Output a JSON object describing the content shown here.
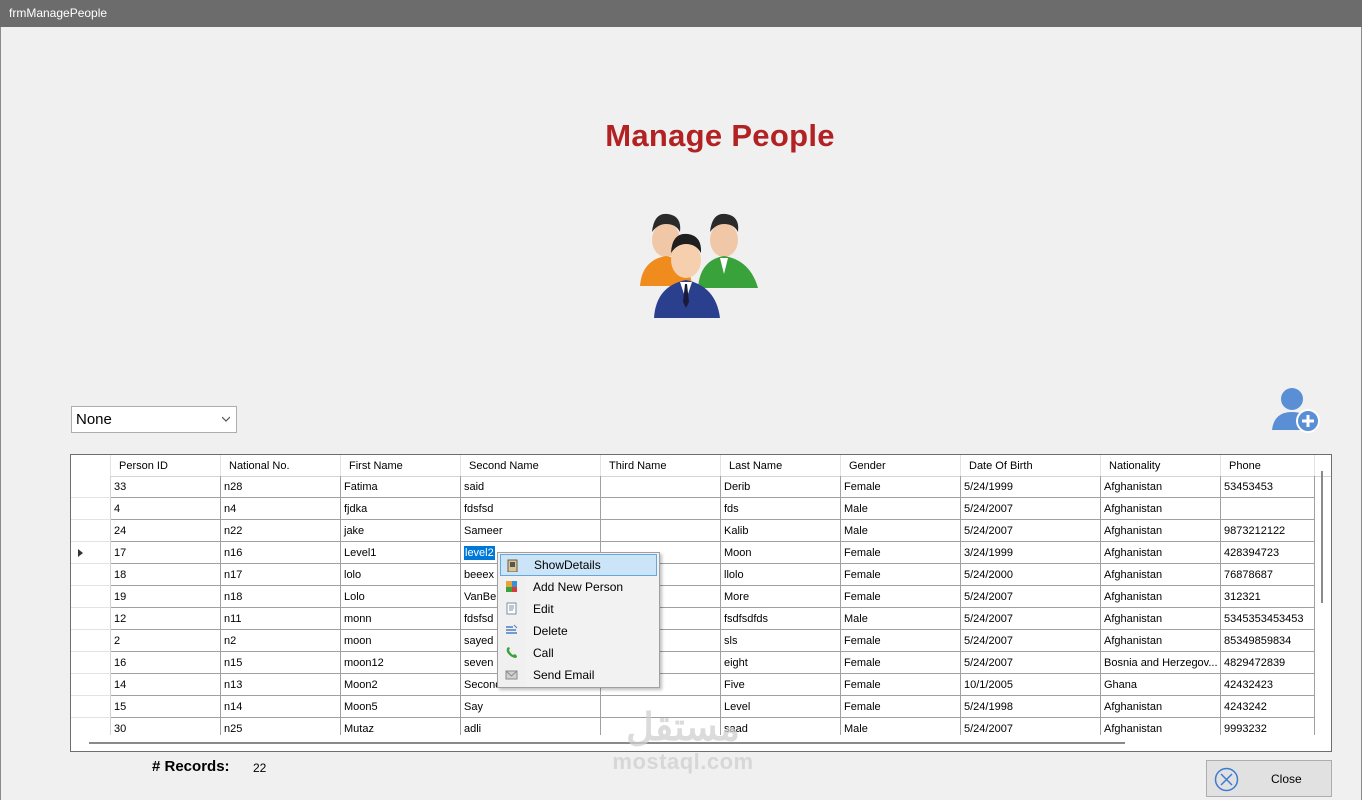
{
  "window": {
    "title": "frmManagePeople"
  },
  "header": {
    "title": "Manage People"
  },
  "filter": {
    "selected": "None"
  },
  "grid": {
    "columns": [
      "Person ID",
      "National No.",
      "First Name",
      "Second Name",
      "Third Name",
      "Last Name",
      "Gender",
      "Date Of Birth",
      "Nationality",
      "Phone"
    ],
    "rows": [
      [
        "33",
        "n28",
        "Fatima",
        "said",
        "",
        "Derib",
        "Female",
        "5/24/1999",
        "Afghanistan",
        "53453453"
      ],
      [
        "4",
        "n4",
        "fjdka",
        "fdsfsd",
        "",
        "fds",
        "Male",
        "5/24/2007",
        "Afghanistan",
        ""
      ],
      [
        "24",
        "n22",
        "jake",
        "Sameer",
        "",
        "Kalib",
        "Male",
        "5/24/2007",
        "Afghanistan",
        "9873212122"
      ],
      [
        "17",
        "n16",
        "Level1",
        "level2",
        "",
        "Moon",
        "Female",
        "3/24/1999",
        "Afghanistan",
        "428394723"
      ],
      [
        "18",
        "n17",
        "lolo",
        "beeex",
        "",
        "llolo",
        "Female",
        "5/24/2000",
        "Afghanistan",
        "76878687"
      ],
      [
        "19",
        "n18",
        "Lolo",
        "VanBe",
        "",
        "More",
        "Female",
        "5/24/2007",
        "Afghanistan",
        "312321"
      ],
      [
        "12",
        "n11",
        "monn",
        "fdsfsd",
        "",
        "fsdfsdfds",
        "Male",
        "5/24/2007",
        "Afghanistan",
        "5345353453453"
      ],
      [
        "2",
        "n2",
        "moon",
        "sayed",
        "",
        "sls",
        "Female",
        "5/24/2007",
        "Afghanistan",
        "85349859834"
      ],
      [
        "16",
        "n15",
        "moon12",
        "seven",
        "",
        "eight",
        "Female",
        "5/24/2007",
        "Bosnia and Herzegov...",
        "4829472839"
      ],
      [
        "14",
        "n13",
        "Moon2",
        "Second",
        "",
        "Five",
        "Female",
        "10/1/2005",
        "Ghana",
        "42432423"
      ],
      [
        "15",
        "n14",
        "Moon5",
        "Say",
        "",
        "Level",
        "Female",
        "5/24/1998",
        "Afghanistan",
        "4243242"
      ],
      [
        "30",
        "n25",
        "Mutaz",
        "adli",
        "",
        "saad",
        "Male",
        "5/24/2007",
        "Afghanistan",
        "9993232"
      ]
    ]
  },
  "context_menu": {
    "items": [
      {
        "label": "ShowDetails",
        "icon": "details-icon"
      },
      {
        "label": "Add New Person",
        "icon": "add-person-icon"
      },
      {
        "label": "Edit",
        "icon": "edit-icon"
      },
      {
        "label": "Delete",
        "icon": "delete-icon"
      },
      {
        "label": "Call",
        "icon": "phone-icon"
      },
      {
        "label": "Send Email",
        "icon": "email-icon"
      }
    ]
  },
  "footer": {
    "records_label": "# Records:",
    "records_count": "22",
    "close_label": "Close"
  },
  "watermark": {
    "arabic": "مستقل",
    "latin": "mostaql.com"
  },
  "colors": {
    "title": "#b22222",
    "selection": "#0078d7",
    "menu_highlight": "#cce4f7"
  }
}
